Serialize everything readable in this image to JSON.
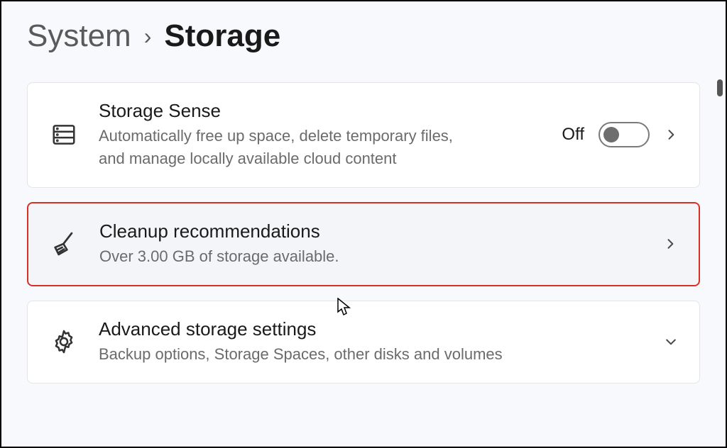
{
  "breadcrumb": {
    "parent": "System",
    "separator": "›",
    "current": "Storage"
  },
  "cards": {
    "storage_sense": {
      "title": "Storage Sense",
      "desc": "Automatically free up space, delete temporary files, and manage locally available cloud content",
      "toggle_state_label": "Off",
      "toggle_on": false
    },
    "cleanup": {
      "title": "Cleanup recommendations",
      "desc": "Over 3.00 GB of storage available."
    },
    "advanced": {
      "title": "Advanced storage settings",
      "desc": "Backup options, Storage Spaces, other disks and volumes"
    }
  },
  "icons": {
    "storage": "storage-drive-icon",
    "broom": "broom-icon",
    "gear": "gear-icon",
    "chevron_right": "chevron-right-icon",
    "chevron_down": "chevron-down-icon"
  }
}
